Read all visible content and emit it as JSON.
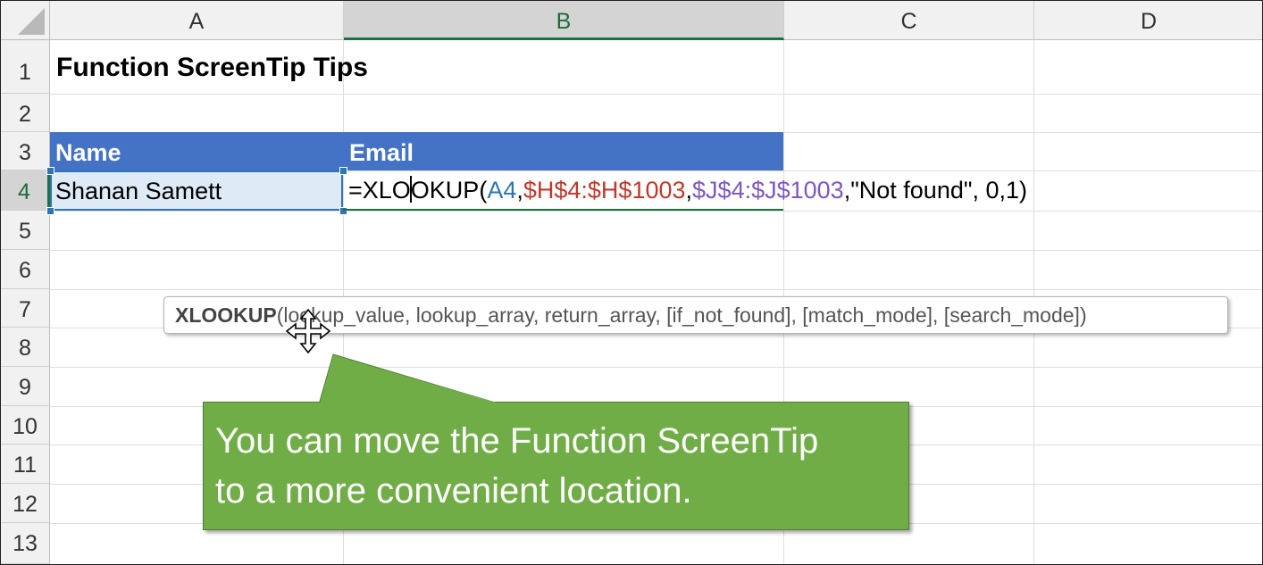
{
  "columns": [
    "A",
    "B",
    "C",
    "D"
  ],
  "rows": [
    "1",
    "2",
    "3",
    "4",
    "5",
    "6",
    "7",
    "8",
    "9",
    "10",
    "11",
    "12",
    "13"
  ],
  "selected_column": "B",
  "selected_row": "4",
  "cells": {
    "A1": "Function ScreenTip Tips",
    "A3": "Name",
    "B3": "Email",
    "A4": "Shanan Samett"
  },
  "formula": {
    "prefix_before_caret": "=XLO",
    "prefix_after_caret": "OKUP(",
    "arg1": "A4",
    "comma1": ",",
    "arg2": "$H$4:$H$1003",
    "comma2": ",",
    "arg3": "$J$4:$J$1003",
    "rest": ",\"Not found\", 0,1)"
  },
  "screentip": {
    "function_name": "XLOOKUP",
    "args": "(lookup_value, lookup_array, return_array, [if_not_found], [match_mode], [search_mode])"
  },
  "callout": {
    "line1": "You can move the Function ScreenTip",
    "line2": "to a more convenient location."
  },
  "colors": {
    "header_fill": "#4472c4",
    "selection_green": "#1e7145",
    "callout_fill": "#70ad47",
    "ref_blue": "#2e75b6",
    "ref_red": "#c0392b",
    "ref_purple": "#7e57c2"
  },
  "icons": [
    "move-cursor-icon",
    "select-all-corner-icon"
  ]
}
